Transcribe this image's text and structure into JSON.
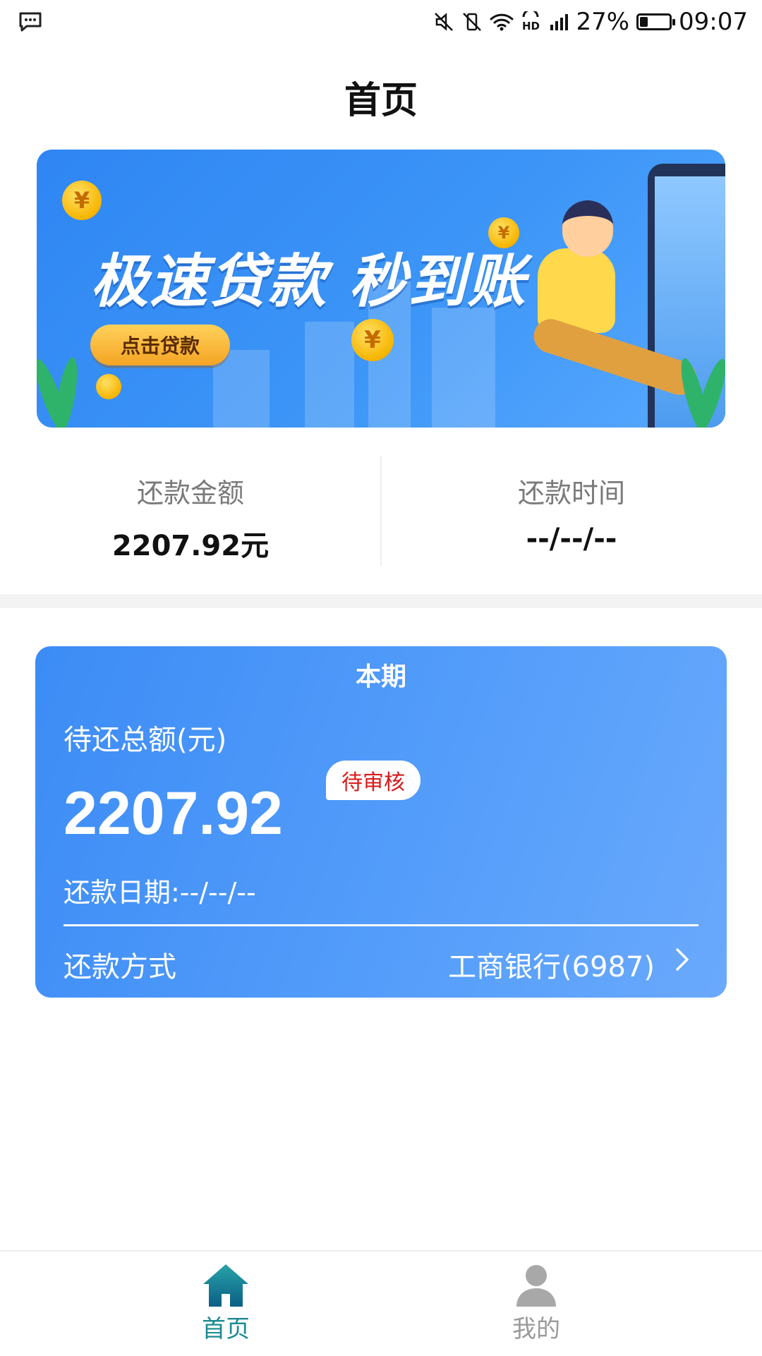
{
  "status_bar": {
    "battery": "27%",
    "battery_level": 0.27,
    "time": "09:07"
  },
  "header": {
    "title": "首页"
  },
  "banner": {
    "headline": "极速贷款 秒到账",
    "button_label": "点击贷款",
    "coin_symbol": "¥"
  },
  "summary": {
    "amount_label": "还款金额",
    "amount_value": "2207.92元",
    "time_label": "还款时间",
    "time_value": "--/--/--"
  },
  "card": {
    "title": "本期",
    "total_label": "待还总额(元)",
    "total_amount": "2207.92",
    "status_badge": "待审核",
    "date_text": "还款日期:--/--/--",
    "method_label": "还款方式",
    "method_value": "工商银行(6987)"
  },
  "tabbar": {
    "home_label": "首页",
    "mine_label": "我的"
  },
  "colors": {
    "card_start": "#3c8cf6",
    "card_end": "#6aa9fc",
    "badge_text": "#d81a1a",
    "tab_active": "#1b8a93",
    "tab_inactive": "#9a9a9a"
  }
}
